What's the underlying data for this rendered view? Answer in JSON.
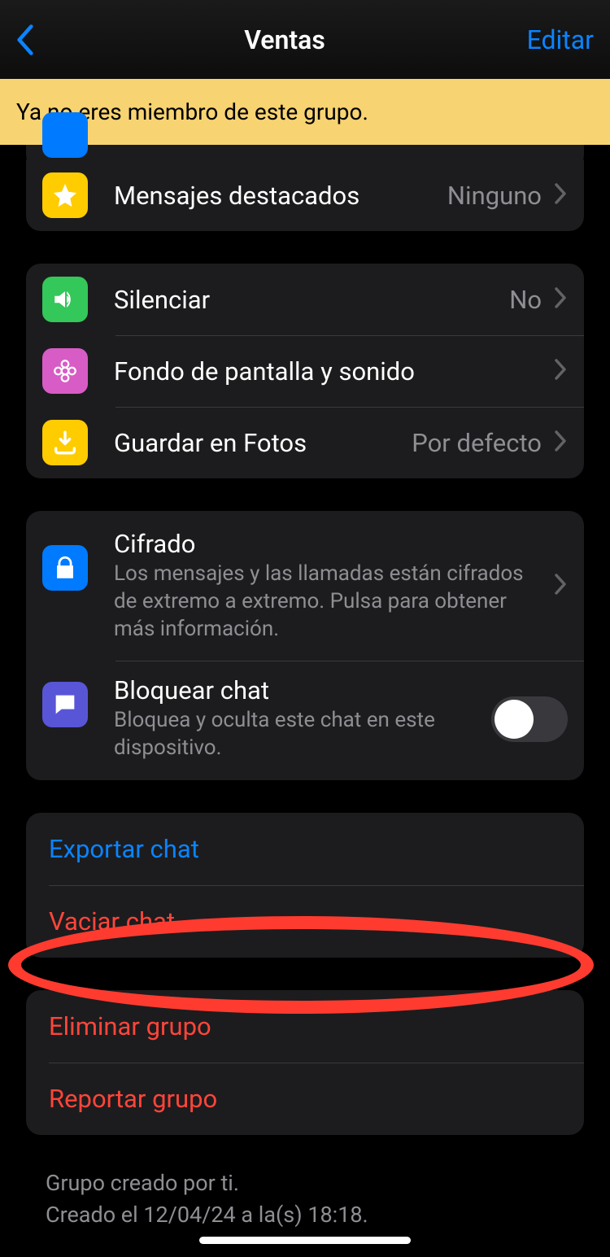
{
  "header": {
    "title": "Ventas",
    "edit": "Editar"
  },
  "banner": "Ya no eres miembro de este grupo.",
  "rows": {
    "starred": {
      "label": "Mensajes destacados",
      "value": "Ninguno"
    },
    "mute": {
      "label": "Silenciar",
      "value": "No"
    },
    "wallpaper": {
      "label": "Fondo de pantalla y sonido"
    },
    "savephotos": {
      "label": "Guardar en Fotos",
      "value": "Por defecto"
    },
    "encryption": {
      "label": "Cifrado",
      "sub": "Los mensajes y las llamadas están cifrados de extremo a extremo. Pulsa para obtener más información."
    },
    "lockchat": {
      "label": "Bloquear chat",
      "sub": "Bloquea y oculta este chat en este dispositivo."
    }
  },
  "actions": {
    "export": "Exportar chat",
    "clear": "Vaciar chat",
    "delete": "Eliminar grupo",
    "report": "Reportar grupo"
  },
  "footer": {
    "line1": "Grupo creado por ti.",
    "line2": "Creado el 12/04/24 a la(s) 18:18."
  }
}
